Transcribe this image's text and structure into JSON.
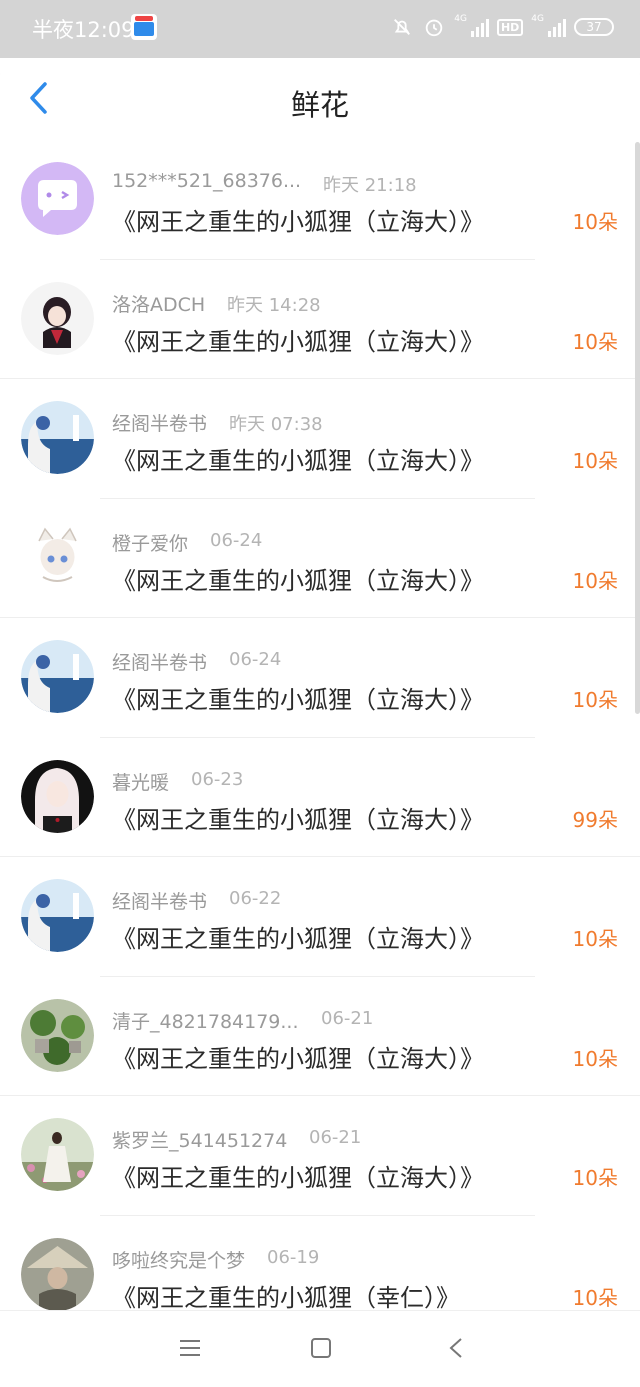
{
  "status_bar": {
    "time": "半夜12:09",
    "network_1": "4G",
    "hd": "HD",
    "network_2": "4G",
    "battery": "37"
  },
  "header": {
    "title": "鲜花",
    "back_icon": "back-chevron-icon"
  },
  "rows": [
    {
      "name": "152***521_68376...",
      "time": "昨天 21:18",
      "book": "《网王之重生的小狐狸（立海大）》",
      "flowers": "10朵",
      "avatar": "purple-chat-avatar"
    },
    {
      "name": "洛洛ADCH",
      "time": "昨天 14:28",
      "book": "《网王之重生的小狐狸（立海大）》",
      "flowers": "10朵",
      "avatar": "anime-dark-avatar"
    },
    {
      "name": "经阁半卷书",
      "time": "昨天 07:38",
      "book": "《网王之重生的小狐狸（立海大）》",
      "flowers": "10朵",
      "avatar": "sea-lighthouse-avatar"
    },
    {
      "name": "橙子爱你",
      "time": "06-24",
      "book": "《网王之重生的小狐狸（立海大）》",
      "flowers": "10朵",
      "avatar": "catgirl-avatar"
    },
    {
      "name": "经阁半卷书",
      "time": "06-24",
      "book": "《网王之重生的小狐狸（立海大）》",
      "flowers": "10朵",
      "avatar": "sea-lighthouse-avatar"
    },
    {
      "name": "暮光暖",
      "time": "06-23",
      "book": "《网王之重生的小狐狸（立海大）》",
      "flowers": "99朵",
      "avatar": "anime-white-hair-avatar"
    },
    {
      "name": "经阁半卷书",
      "time": "06-22",
      "book": "《网王之重生的小狐狸（立海大）》",
      "flowers": "10朵",
      "avatar": "sea-lighthouse-avatar"
    },
    {
      "name": "清子_4821784179...",
      "time": "06-21",
      "book": "《网王之重生的小狐狸（立海大）》",
      "flowers": "10朵",
      "avatar": "plants-avatar"
    },
    {
      "name": "紫罗兰_541451274",
      "time": "06-21",
      "book": "《网王之重生的小狐狸（立海大）》",
      "flowers": "10朵",
      "avatar": "garden-girl-avatar"
    },
    {
      "name": "哆啦终究是个梦",
      "time": "06-19",
      "book": "《网王之重生的小狐狸（幸仁）》",
      "flowers": "10朵",
      "avatar": "straw-hat-avatar"
    }
  ],
  "nav": {
    "menu_icon": "menu-icon",
    "home_icon": "home-square-icon",
    "back_icon": "back-triangle-icon"
  },
  "colors": {
    "accent_blue": "#2f8bea",
    "flower_orange": "#f07b2e",
    "status_bar_bg": "#d4d4d4"
  }
}
